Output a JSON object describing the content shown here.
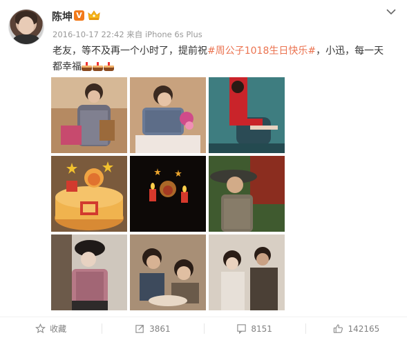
{
  "author": {
    "name": "陈坤",
    "verified_badge": "V",
    "meta": "2016-10-17 22:42 来自 iPhone 6s Plus"
  },
  "post": {
    "text_before": "老友，等不及再一个小时了，提前祝",
    "hashtag": "#周公子1018生日快乐#",
    "text_after": "，小迅，每一天都幸福"
  },
  "photos": [
    {
      "name": "photo-1",
      "alt_icon": "image"
    },
    {
      "name": "photo-2",
      "alt_icon": "image"
    },
    {
      "name": "photo-3",
      "alt_icon": "image"
    },
    {
      "name": "photo-4",
      "alt_icon": "image"
    },
    {
      "name": "photo-5",
      "alt_icon": "image"
    },
    {
      "name": "photo-6",
      "alt_icon": "image"
    },
    {
      "name": "photo-7",
      "alt_icon": "image"
    },
    {
      "name": "photo-8",
      "alt_icon": "image"
    },
    {
      "name": "photo-9",
      "alt_icon": "image"
    }
  ],
  "actions": {
    "favorite_label": "收藏",
    "repost_count": "3861",
    "comment_count": "8151",
    "like_count": "142165"
  },
  "colors": {
    "hashtag": "#eb7350",
    "verified": "#f27a1a",
    "meta": "#999999"
  }
}
